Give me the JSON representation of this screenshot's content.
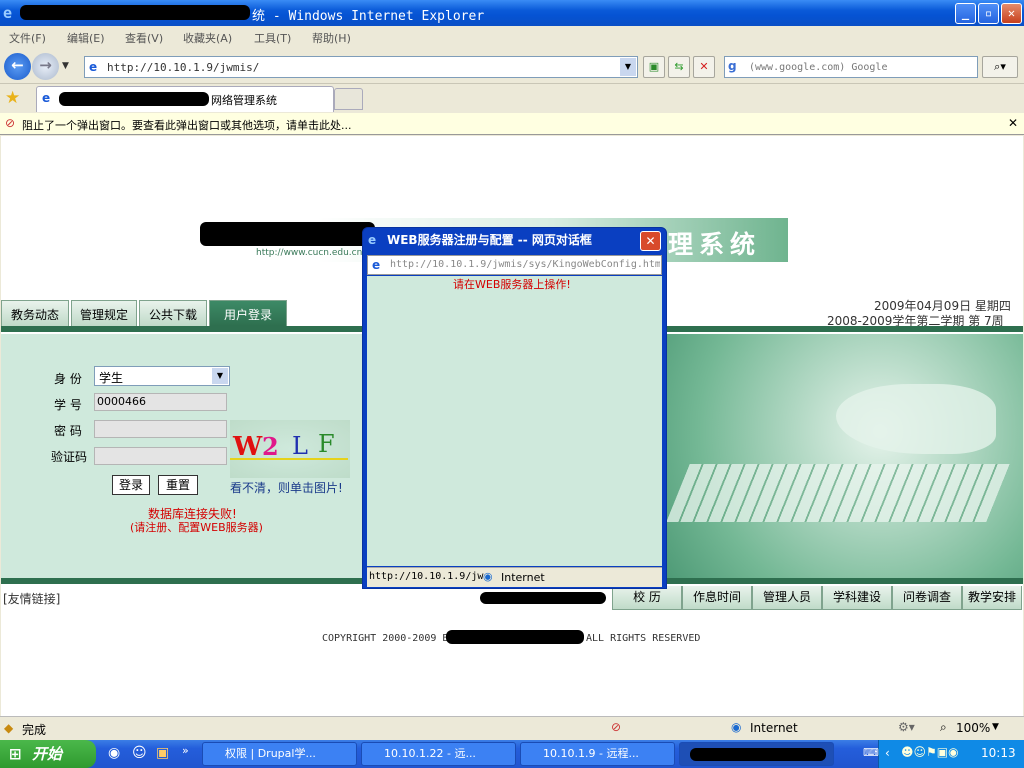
{
  "window": {
    "title_suffix": "统 - Windows Internet Explorer"
  },
  "menu": [
    "文件(F)",
    "编辑(E)",
    "查看(V)",
    "收藏夹(A)",
    "工具(T)",
    "帮助(H)"
  ],
  "address": {
    "url": "http://10.10.1.9/jwmis/"
  },
  "search": {
    "placeholder": "(www.google.com) Google"
  },
  "tab": {
    "title_suffix": "网络管理系统"
  },
  "infobar": {
    "message": "阻止了一个弹出窗口。要查看此弹出窗口或其他选项，请单击此处..."
  },
  "site": {
    "banner_url": "http://www.cucn.edu.cn/",
    "banner_title_suffix": "理系统",
    "nav_tabs": [
      "教务动态",
      "管理规定",
      "公共下载",
      "用户登录"
    ],
    "date": "2009年04月09日 星期四",
    "term": "2008-2009学年第二学期 第 7周",
    "login": {
      "role_label": "身 份",
      "role_value": "学生",
      "id_label": "学 号",
      "id_value": "0000466",
      "pwd_label": "密 码",
      "captcha_label": "验证码",
      "captcha_text": [
        "W",
        "2",
        "L",
        "F"
      ],
      "login_button": "登录",
      "reset_button": "重置",
      "refresh_hint": "看不清，则单击图片!",
      "error": "数据库连接失败!",
      "error_hint": "(请注册、配置WEB服务器)"
    },
    "links_label": "[友情链接]",
    "bottom_tabs": [
      "校 历",
      "作息时间",
      "管理人员",
      "学科建设",
      "问卷调查",
      "教学安排"
    ],
    "copyright_prefix": "COPYRIGHT 2000-2009 BY",
    "copyright_suffix": "ALL RIGHTS RESERVED"
  },
  "dialog": {
    "title": "WEB服务器注册与配置 -- 网页对话框",
    "url": "http://10.10.1.9/jwmis/sys/KingoWebConfig.htm",
    "message": "请在WEB服务器上操作!",
    "status_url": "http://10.10.1.9/jw",
    "zone": "Internet"
  },
  "statusbar": {
    "text": "完成",
    "zone": "Internet",
    "zoom": "100%"
  },
  "taskbar": {
    "start": "开始",
    "tasks": [
      "权限 | Drupal学...",
      "10.10.1.22 - 远...",
      "10.10.1.9 - 远程..."
    ],
    "clock": "10:13"
  },
  "colors": {
    "accent": "#2e6f4f",
    "error": "#d40000",
    "titlebar": "#0553d3"
  }
}
